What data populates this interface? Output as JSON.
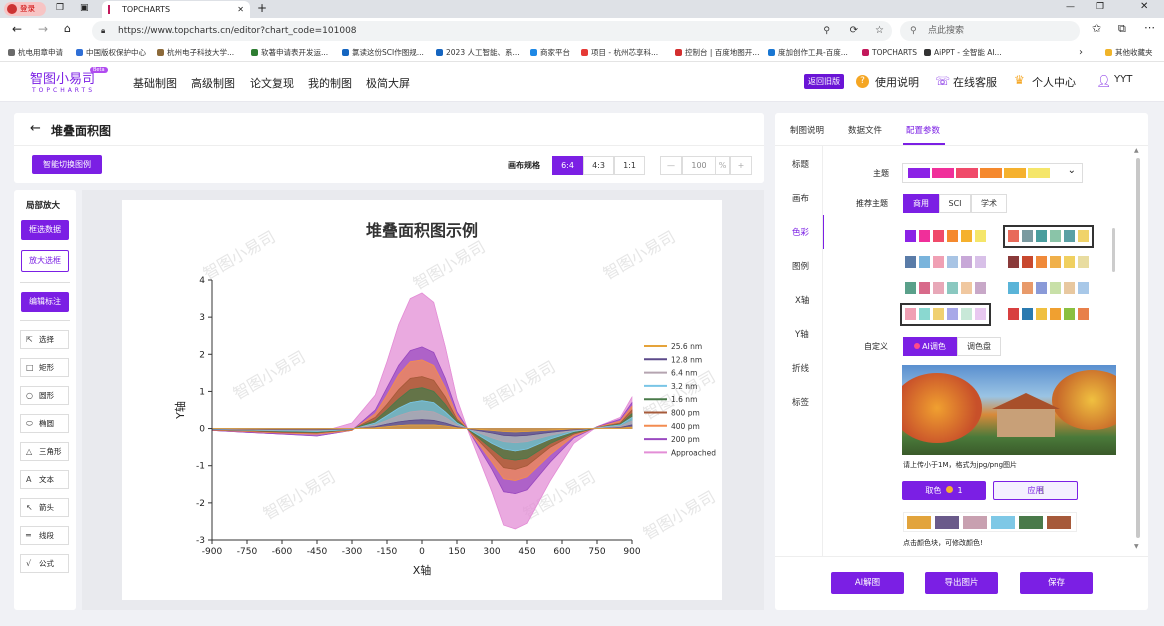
{
  "browser": {
    "login_label": "登录",
    "tab_title": "TOPCHARTS",
    "url": "https://www.topcharts.cn/editor?chart_code=101008",
    "search_placeholder": "点此搜索",
    "bookmarks": [
      {
        "label": "杭电用章申请",
        "color": "#6a6a6a"
      },
      {
        "label": "中国版权保护中心",
        "color": "#2f6fd6"
      },
      {
        "label": "杭州电子科技大学...",
        "color": "#8c6a3a"
      },
      {
        "label": "软著申请表开发运...",
        "color": "#2e7d32"
      },
      {
        "label": "氯读这份SCI作图规...",
        "color": "#1565c0"
      },
      {
        "label": "2023 人工智能、系...",
        "color": "#1565c0"
      },
      {
        "label": "商家平台",
        "color": "#1e88e5"
      },
      {
        "label": "项目 - 杭州芯享科...",
        "color": "#e53935"
      },
      {
        "label": "控制台 | 百度地图开...",
        "color": "#d32f2f"
      },
      {
        "label": "度加创作工具-百度...",
        "color": "#1976d2"
      },
      {
        "label": "TOPCHARTS",
        "color": "#c2185b"
      },
      {
        "label": "AiPPT - 全智能 AI...",
        "color": "#333333"
      },
      {
        "label": "其他收藏夹",
        "color": "#f0b429"
      }
    ]
  },
  "header": {
    "logo": "智图小易司",
    "logo_sub": "TOPCHARTS",
    "beta": "Beta",
    "nav": [
      "基础制图",
      "高级制图",
      "论文复现",
      "我的制图",
      "极简大屏"
    ],
    "old_version": "返回旧版",
    "help": "使用说明",
    "service": "在线客服",
    "personal": "个人中心",
    "user": "YYT"
  },
  "editor": {
    "title": "堆叠面积图",
    "smart_switch": "智能切换图例",
    "canvas_size_label": "画布规格",
    "ratios": [
      "6:4",
      "4:3",
      "1:1"
    ],
    "zoom": "100",
    "zoom_unit": "%",
    "zoom_minus": "—",
    "zoom_plus": "+"
  },
  "left_tools": {
    "zoom_title": "局部放大",
    "select_data": "框选数据",
    "zoom_box": "放大选框",
    "edit_annot": "编辑标注",
    "tools": [
      {
        "label": "选择",
        "icon": "⇱"
      },
      {
        "label": "矩形",
        "icon": "□"
      },
      {
        "label": "圆形",
        "icon": "○"
      },
      {
        "label": "椭圆",
        "icon": "⬭"
      },
      {
        "label": "三角形",
        "icon": "△"
      },
      {
        "label": "文本",
        "icon": "A"
      },
      {
        "label": "箭头",
        "icon": "↖"
      },
      {
        "label": "线段",
        "icon": "═"
      },
      {
        "label": "公式",
        "icon": "√"
      }
    ]
  },
  "chart_data": {
    "type": "area",
    "title": "堆叠面积图示例",
    "xlabel": "X轴",
    "ylabel": "Y轴",
    "xlim": [
      -900,
      900
    ],
    "ylim": [
      -3,
      4
    ],
    "xticks": [
      -900,
      -750,
      -600,
      -450,
      -300,
      -150,
      0,
      150,
      300,
      450,
      600,
      750,
      900
    ],
    "yticks": [
      -3,
      -2,
      -1,
      0,
      1,
      2,
      3,
      4
    ],
    "x": [
      -900,
      -750,
      -600,
      -450,
      -300,
      -200,
      -150,
      -100,
      -50,
      0,
      50,
      100,
      150,
      200,
      300,
      350,
      400,
      450,
      550,
      650,
      750,
      850,
      900
    ],
    "legend_position": "right",
    "series": [
      {
        "name": "Approached",
        "color": "#e38ed6",
        "values": [
          -0.05,
          -0.1,
          -0.15,
          -0.12,
          0.15,
          0.9,
          1.8,
          2.8,
          3.5,
          3.65,
          3.4,
          2.2,
          0.8,
          -0.1,
          -1.7,
          -2.6,
          -2.7,
          -2.55,
          -1.4,
          -0.4,
          0.05,
          0.3,
          0.85
        ]
      },
      {
        "name": "200 pm",
        "color": "#9a49c0",
        "values": [
          -0.05,
          -0.1,
          -0.15,
          -0.2,
          -0.05,
          0.5,
          1.1,
          1.7,
          2.1,
          2.2,
          2.05,
          1.35,
          0.45,
          -0.05,
          -1.1,
          -1.7,
          -1.75,
          -1.65,
          -0.9,
          -0.25,
          0.05,
          0.25,
          0.7
        ]
      },
      {
        "name": "400 pm",
        "color": "#f38c50",
        "values": [
          -0.04,
          -0.08,
          -0.12,
          -0.15,
          -0.05,
          0.4,
          0.9,
          1.45,
          1.8,
          1.85,
          1.7,
          1.1,
          0.35,
          -0.05,
          -0.9,
          -1.35,
          -1.4,
          -1.3,
          -0.7,
          -0.2,
          0.04,
          0.2,
          0.6
        ]
      },
      {
        "name": "800 pm",
        "color": "#a65a3a",
        "values": [
          -0.03,
          -0.06,
          -0.1,
          -0.12,
          -0.03,
          0.3,
          0.65,
          1.05,
          1.35,
          1.4,
          1.3,
          0.85,
          0.25,
          -0.04,
          -0.7,
          -1.05,
          -1.1,
          -1.0,
          -0.5,
          -0.15,
          0.03,
          0.15,
          0.5
        ]
      },
      {
        "name": "1.6 nm",
        "color": "#4a7a4a",
        "values": [
          -0.02,
          -0.05,
          -0.08,
          -0.1,
          -0.02,
          0.22,
          0.5,
          0.8,
          1.05,
          1.1,
          1.0,
          0.65,
          0.2,
          -0.03,
          -0.55,
          -0.8,
          -0.85,
          -0.8,
          -0.4,
          -0.12,
          0.02,
          0.12,
          0.4
        ]
      },
      {
        "name": "3.2 nm",
        "color": "#79c5e6",
        "values": [
          -0.02,
          -0.04,
          -0.06,
          -0.08,
          -0.02,
          0.15,
          0.35,
          0.55,
          0.7,
          0.75,
          0.7,
          0.45,
          0.15,
          -0.02,
          -0.4,
          -0.55,
          -0.6,
          -0.55,
          -0.28,
          -0.08,
          0.02,
          0.1,
          0.3
        ]
      },
      {
        "name": "6.4 nm",
        "color": "#b5a4b0",
        "values": [
          -0.01,
          -0.03,
          -0.04,
          -0.05,
          -0.01,
          0.1,
          0.22,
          0.35,
          0.45,
          0.48,
          0.45,
          0.3,
          0.1,
          -0.01,
          -0.25,
          -0.35,
          -0.38,
          -0.35,
          -0.18,
          -0.05,
          0.01,
          0.06,
          0.2
        ]
      },
      {
        "name": "12.8 nm",
        "color": "#5c4a8a",
        "values": [
          -0.01,
          -0.02,
          -0.03,
          -0.03,
          -0.01,
          0.05,
          0.12,
          0.18,
          0.22,
          0.24,
          0.22,
          0.15,
          0.05,
          -0.01,
          -0.12,
          -0.18,
          -0.2,
          -0.18,
          -0.1,
          -0.03,
          0.0,
          0.03,
          0.1
        ]
      },
      {
        "name": "25.6 nm",
        "color": "#e5a33a",
        "values": [
          0,
          -0.01,
          -0.01,
          -0.01,
          0,
          0.02,
          0.05,
          0.08,
          0.1,
          0.1,
          0.1,
          0.07,
          0.02,
          0,
          -0.05,
          -0.08,
          -0.09,
          -0.08,
          -0.04,
          -0.01,
          0,
          0.01,
          0.04
        ]
      }
    ],
    "legend_order": [
      "25.6 nm",
      "12.8 nm",
      "6.4 nm",
      "3.2 nm",
      "1.6 nm",
      "800 pm",
      "400 pm",
      "200 pm",
      "Approached"
    ],
    "watermark": "智图小易司"
  },
  "right_panel": {
    "tabs": [
      "制图说明",
      "数据文件",
      "配置参数"
    ],
    "side": [
      "标题",
      "画布",
      "色彩",
      "图例",
      "X轴",
      "Y轴",
      "折线",
      "标签"
    ],
    "theme_label": "主题",
    "theme_colors": [
      "#8b22e6",
      "#f02f9a",
      "#f04a6a",
      "#f5892e",
      "#f5b12e",
      "#f5e66a"
    ],
    "recommend_label": "推荐主题",
    "recommend_tabs": [
      "商用",
      "SCI",
      "学术"
    ],
    "palettes": [
      [
        "#8b22e6",
        "#f02f9a",
        "#f04a6a",
        "#f5892e",
        "#f5b12e",
        "#f5e66a"
      ],
      [
        "#e86a5a",
        "#7a9aa0",
        "#4a9e9e",
        "#8ac4a8",
        "#5aa0a4",
        "#f0d36a"
      ],
      [
        "#5a7ca8",
        "#7ab4dc",
        "#f0a0b4",
        "#a8c4e4",
        "#c8a8d8",
        "#d8c0e8"
      ],
      [
        "#8a3a3a",
        "#c8482e",
        "#f08a3a",
        "#f0b04a",
        "#f0d060",
        "#e8dca0"
      ],
      [
        "#5aa08a",
        "#d86a8a",
        "#e8a8b8",
        "#8ac8c0",
        "#f0c8a0",
        "#c8a8c8"
      ],
      [
        "#5ab4d8",
        "#e89a6a",
        "#8a9ad8",
        "#c8e0a8",
        "#e8c8a0",
        "#a8c8e8"
      ],
      [
        "#f0a0b4",
        "#8ad8d0",
        "#f0d070",
        "#a8a8e8",
        "#c8e8d8",
        "#e8c8f0"
      ],
      [
        "#d84040",
        "#2a7ab0",
        "#f0c040",
        "#f0a030",
        "#8ac040",
        "#e8804a"
      ]
    ],
    "custom_label": "自定义",
    "ai_color": "AI调色",
    "palette_tab": "调色盘",
    "upload_hint": "请上传小于1M，格式为jpg/png图片",
    "pick_color": "取色",
    "pick_count": "1",
    "apply": "应用",
    "picked_colors": [
      "#e2a43c",
      "#6a5a8a",
      "#c8a0b0",
      "#7ec8e6",
      "#4a7a4a",
      "#a65a3a"
    ],
    "click_hint": "点击颜色块，可修改颜色!"
  },
  "footer_buttons": [
    "AI解图",
    "导出图片",
    "保存"
  ]
}
